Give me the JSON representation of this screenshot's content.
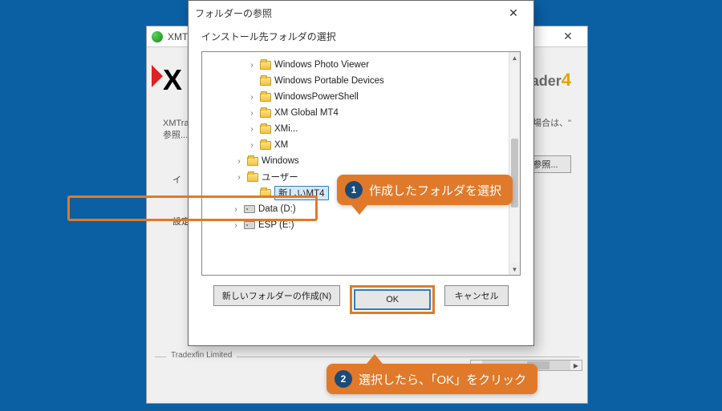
{
  "bg": {
    "title": "XMT...",
    "logo_right_a": "taTrader",
    "logo_right_b": "4",
    "text1a": "XMTrad...",
    "text1b": "参照...",
    "text1c": "る場合は、\"",
    "label_install": "イ",
    "browse": "参照...",
    "label_settings": "設定で",
    "legend": "Tradexfin Limited"
  },
  "dlg": {
    "title": "フォルダーの参照",
    "subtitle": "インストール先フォルダの選択",
    "newfolder": "新しいフォルダーの作成(N)",
    "ok": "OK",
    "cancel": "キャンセル"
  },
  "tree": {
    "n0": "Windows Photo Viewer",
    "n1": "Windows Portable Devices",
    "n2": "WindowsPowerShell",
    "n3": "XM Global MT4",
    "n4": "XMi...",
    "n5": "XM",
    "n6": "Windows",
    "n7": "ユーザー",
    "n8": "新しいMT4",
    "n9": "Data (D:)",
    "n10": "ESP (E:)"
  },
  "call": {
    "c1": "作成したフォルダを選択",
    "c2": "選択したら、「OK」をクリック"
  }
}
